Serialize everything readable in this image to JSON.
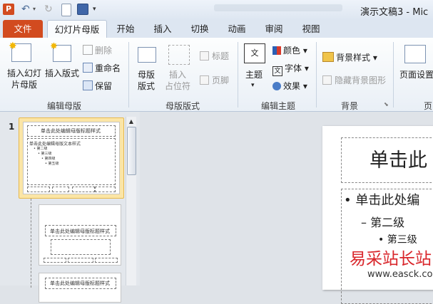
{
  "title_bar": {
    "title": "演示文稿3 - Mic"
  },
  "tabs": [
    {
      "label": "文件"
    },
    {
      "label": "幻灯片母版"
    },
    {
      "label": "开始"
    },
    {
      "label": "插入"
    },
    {
      "label": "切换"
    },
    {
      "label": "动画"
    },
    {
      "label": "审阅"
    },
    {
      "label": "视图"
    }
  ],
  "ribbon": {
    "edit_master": {
      "insert_slide_master": "插入幻灯\n片母版",
      "insert_layout": "插入版式",
      "delete": "删除",
      "rename": "重命名",
      "preserve": "保留",
      "label": "编辑母版"
    },
    "master_layout": {
      "master_layout_btn": "母版\n版式",
      "insert_placeholder": "插入\n占位符",
      "title_check": "标题",
      "footer_check": "页脚",
      "label": "母版版式"
    },
    "edit_theme": {
      "themes": "主题",
      "colors": "颜色",
      "fonts": "字体",
      "effects": "效果",
      "label": "编辑主题"
    },
    "background": {
      "styles": "背景样式",
      "hide_graphics": "隐藏背景图形",
      "label": "背景"
    },
    "page_setup": {
      "label": "页面设置",
      "group_label": "页"
    }
  },
  "thumbnails": {
    "slide_number": "1",
    "master_title": "单击此处编辑母版标题样式",
    "master_text": "单击此处编辑母版文本样式",
    "level2": "• 第二级",
    "level3": "• 第三级",
    "level4": "• 第四级",
    "level5": "• 第五级",
    "layout_title": "单击此处编辑母版标题样式"
  },
  "slide": {
    "title": "单击此",
    "bullet1": "• 单击此处编",
    "bullet2": "– 第二级",
    "bullet3": "• 第三级"
  },
  "watermark": {
    "text": "易采站长站",
    "url": "www.easck.com"
  }
}
